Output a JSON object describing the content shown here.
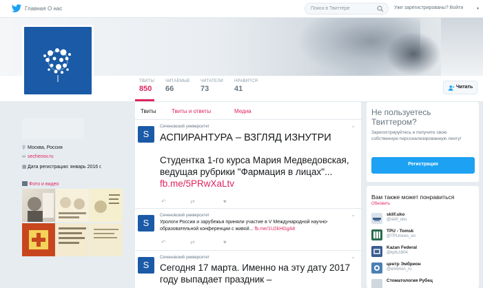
{
  "topnav": {
    "home": "Главная",
    "about": "О нас",
    "search_placeholder": "Поиск в Твиттере",
    "login_prompt": "Уже зарегистрированы?",
    "login_link": "Войти"
  },
  "stats": [
    {
      "label": "ТВИТЫ",
      "value": "850"
    },
    {
      "label": "ЧИТАЕМЫЕ",
      "value": "66"
    },
    {
      "label": "ЧИТАТЕЛИ",
      "value": "73"
    },
    {
      "label": "НРАВИТСЯ",
      "value": "41"
    }
  ],
  "follow_label": "Читать",
  "profile": {
    "location": "Москва, Россия",
    "website": "sechenov.ru",
    "joined": "Дата регистрации: январь 2016 г.",
    "media_title": "Фото и видео"
  },
  "tabs": [
    "Твиты",
    "Твиты и ответы",
    "Медиа"
  ],
  "tweets": [
    {
      "author": "Сеченовский университет",
      "heading": "АСПИРАНТУРА – ВЗГЛЯД ИЗНУТРИ",
      "body": "Студентка 1-го курса Мария Медведовская, ведущая рубрики \"Фармация в лицах\"...",
      "link": "fb.me/5PRwXaLtv"
    },
    {
      "author": "Сеченовский университет",
      "body": "Урологи России и зарубежья приняли участие в V Международной научно-образовательной конференции с живой...",
      "link": "fb.me/1U2kHGgA8"
    },
    {
      "author": "Сеченовский университет",
      "body": "Сегодня 17 марта. Именно на эту дату 2017 году выпадает праздник –"
    }
  ],
  "signup": {
    "title": "Не пользуетесь Твиттером?",
    "desc": "Зарегистрируйтесь и получите свою собственную персонализированную ленту!",
    "button": "Регистрация"
  },
  "wtf": {
    "title": "Вам также может понравиться",
    "refresh": "Обновить",
    "accounts": [
      {
        "name": "sklif.uko",
        "handle": "@sklif_uko",
        "color": "#d9e2ea"
      },
      {
        "name": "TPU - Tomsk",
        "handle": "@TPUnews_en",
        "color": "#2a6b4f"
      },
      {
        "name": "Kazan Federal",
        "handle": "@kpfu1804",
        "color": "#3b5d8f"
      },
      {
        "name": "центр Эмбрион",
        "handle": "@embrion_ru",
        "color": "#4a7fb5"
      },
      {
        "name": "Стоматология Рубец",
        "handle": "",
        "color": "#cfd8df"
      }
    ]
  },
  "colors": {
    "accent": "#e0245e",
    "brand": "#1a5aa6",
    "button": "#1da1f2"
  }
}
